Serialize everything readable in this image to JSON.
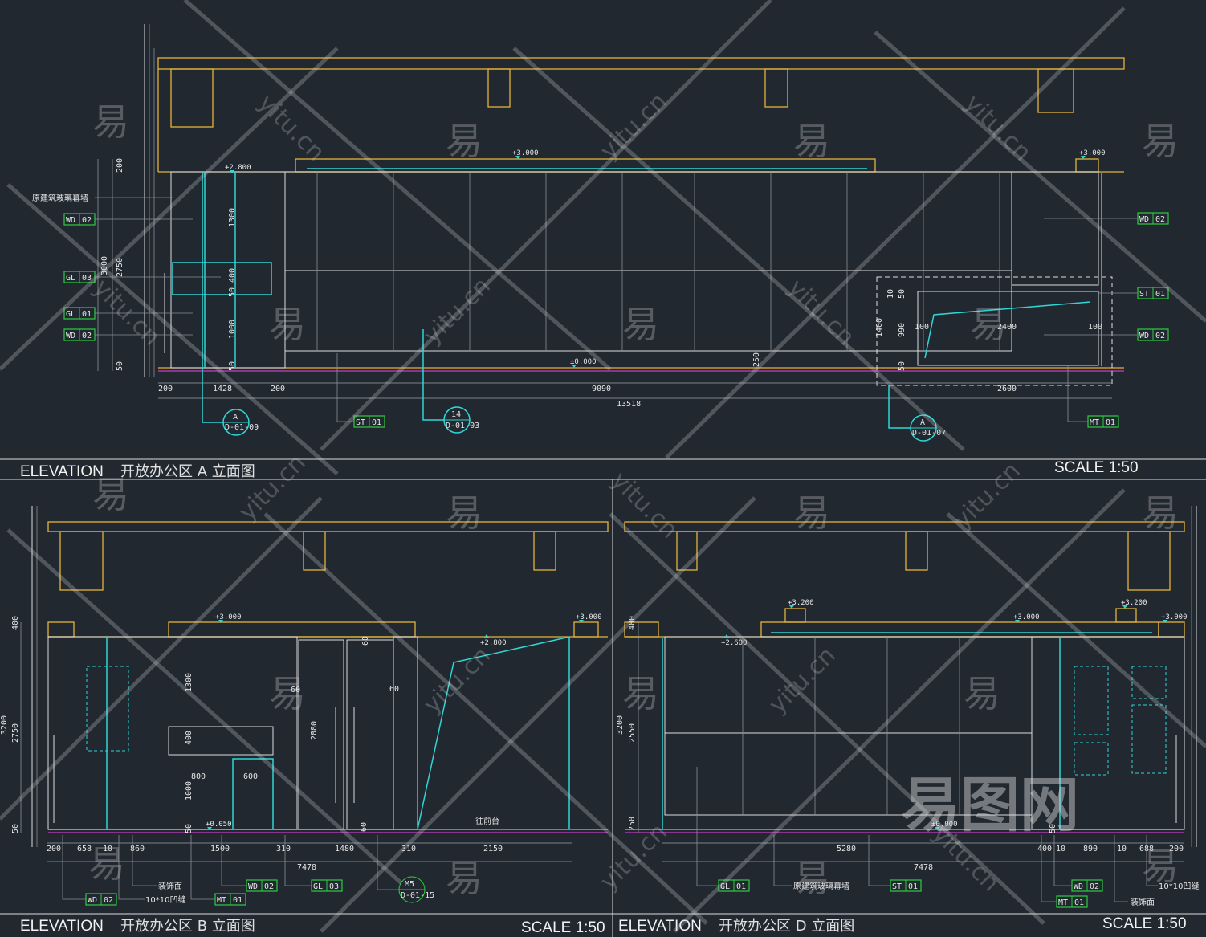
{
  "panels": {
    "a": {
      "title_prefix": "ELEVATION",
      "title": "开放办公区 A 立面图",
      "scale": "SCALE 1:50",
      "note_wall": "原建筑玻璃幕墙",
      "dims": [
        "200",
        "1428",
        "200",
        "9090",
        "2600",
        "13518",
        "200",
        "3000",
        "2750",
        "1300",
        "400",
        "50",
        "1000",
        "50",
        "50",
        "10",
        "50",
        "1400",
        "990",
        "50",
        "100",
        "2400",
        "100",
        "250"
      ],
      "levels": [
        "+2.800",
        "+3.000",
        "+3.000",
        "±0.000"
      ],
      "tags": [
        {
          "code": "WD",
          "num": "02"
        },
        {
          "code": "GL",
          "num": "03"
        },
        {
          "code": "GL",
          "num": "01"
        },
        {
          "code": "WD",
          "num": "02"
        },
        {
          "code": "WD",
          "num": "02"
        },
        {
          "code": "ST",
          "num": "01"
        },
        {
          "code": "WD",
          "num": "02"
        },
        {
          "code": "MT",
          "num": "01"
        },
        {
          "code": "ST",
          "num": "01"
        }
      ],
      "callouts": [
        {
          "top": "A",
          "bottom": "D-01-09"
        },
        {
          "top": "14",
          "bottom": "D-01-03"
        },
        {
          "top": "A",
          "bottom": "D-01-07"
        }
      ]
    },
    "b": {
      "title_prefix": "ELEVATION",
      "title": "开放办公区 B 立面图",
      "scale": "SCALE 1:50",
      "dims": [
        "400",
        "3200",
        "2750",
        "50",
        "200",
        "658",
        "10",
        "860",
        "1500",
        "310",
        "1480",
        "310",
        "2150",
        "7478",
        "1300",
        "400",
        "2880",
        "60",
        "60",
        "60",
        "60",
        "800",
        "600",
        "1000",
        "50"
      ],
      "levels": [
        "+3.000",
        "+3.000",
        "+2.800",
        "+0.050"
      ],
      "notes": [
        "往前台",
        "装饰面",
        "10*10凹缝"
      ],
      "tags": [
        {
          "code": "WD",
          "num": "02"
        },
        {
          "code": "MT",
          "num": "01"
        },
        {
          "code": "WD",
          "num": "02"
        },
        {
          "code": "GL",
          "num": "03"
        }
      ],
      "callouts": [
        {
          "top": "M5",
          "bottom": "D-01-15"
        }
      ]
    },
    "d": {
      "title_prefix": "ELEVATION",
      "title": "开放办公区 D 立面图",
      "scale": "SCALE 1:50",
      "dims": [
        "400",
        "3200",
        "2550",
        "250",
        "50",
        "5280",
        "400",
        "10",
        "890",
        "10",
        "688",
        "200",
        "7478"
      ],
      "levels": [
        "+3.200",
        "+3.200",
        "+3.000",
        "+3.000",
        "+2.600",
        "±0.000"
      ],
      "notes": [
        "原建筑玻璃幕墙",
        "装饰面",
        "10*10凹缝"
      ],
      "tags": [
        {
          "code": "GL",
          "num": "01"
        },
        {
          "code": "ST",
          "num": "01"
        },
        {
          "code": "WD",
          "num": "02"
        },
        {
          "code": "MT",
          "num": "01"
        }
      ]
    }
  },
  "watermark": {
    "char": "易",
    "site": "yitu.cn",
    "logo": "易图网"
  },
  "colors": {
    "background": "#212830",
    "outline": "#e3b33a",
    "floor": "#c83cc8",
    "glass_frame": "#2fd6d6",
    "tag": "#2ecc40"
  }
}
